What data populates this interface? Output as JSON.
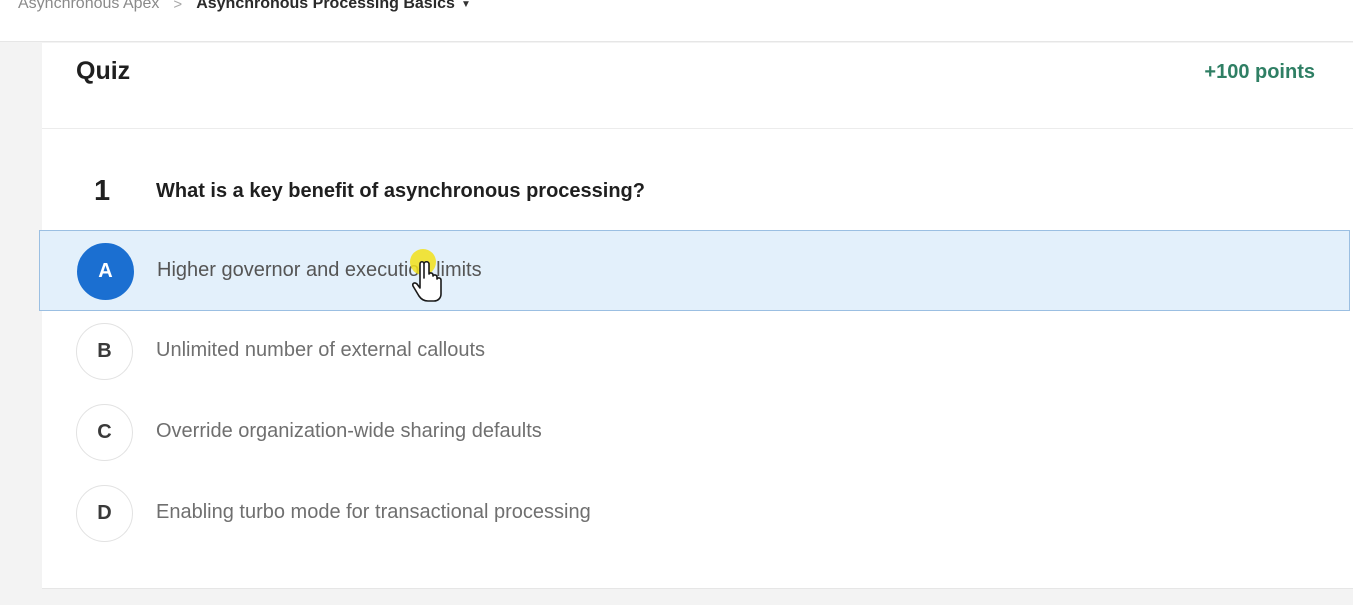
{
  "breadcrumb": {
    "parent": "Asynchronous Apex",
    "separator": ">",
    "current": "Asynchronous Processing Basics",
    "caret": "▼"
  },
  "quiz": {
    "title": "Quiz",
    "points": "+100 points",
    "question_number": "1",
    "question_text": "What is a key benefit of asynchronous processing?",
    "options": [
      {
        "letter": "A",
        "text": "Higher governor and execution limits",
        "selected": true
      },
      {
        "letter": "B",
        "text": "Unlimited number of external callouts",
        "selected": false
      },
      {
        "letter": "C",
        "text": "Override organization-wide sharing defaults",
        "selected": false
      },
      {
        "letter": "D",
        "text": "Enabling turbo mode for transactional processing",
        "selected": false
      }
    ]
  },
  "colors": {
    "accent": "#1b6fd1",
    "selected_bg": "#e3f0fb",
    "points_green": "#2f7f64",
    "cursor_highlight": "#f2e11a"
  },
  "icons": {
    "cursor": "hand-pointer-icon",
    "caret": "caret-down-icon"
  }
}
